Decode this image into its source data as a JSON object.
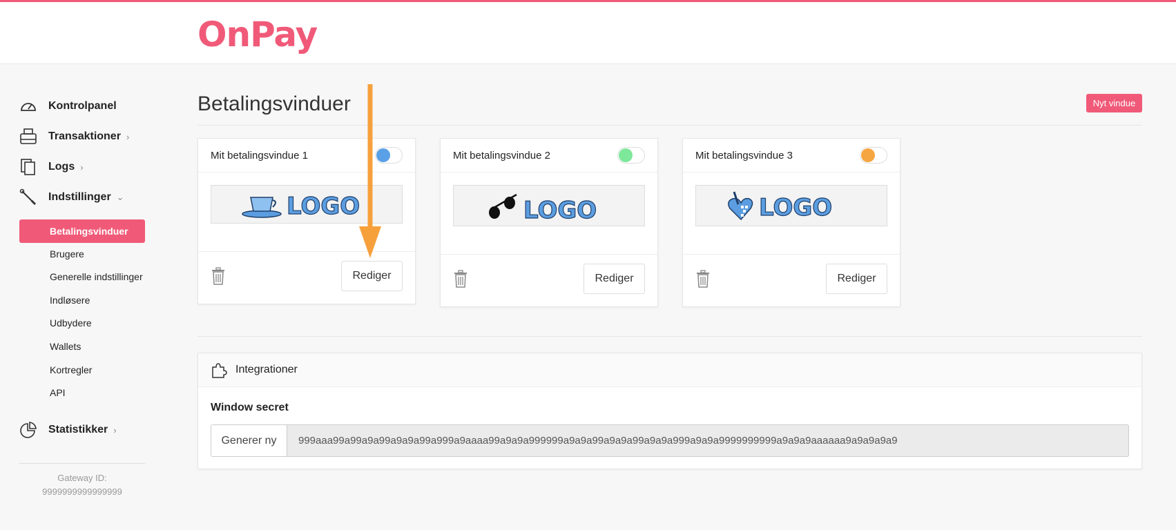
{
  "brand": {
    "name": "OnPay",
    "color": "#f05a78"
  },
  "sidebar": {
    "items": [
      {
        "label": "Kontrolpanel",
        "icon": "gauge-icon",
        "chevron": ""
      },
      {
        "label": "Transaktioner",
        "icon": "cash-register-icon",
        "chevron": "›"
      },
      {
        "label": "Logs",
        "icon": "documents-icon",
        "chevron": "›"
      },
      {
        "label": "Indstillinger",
        "icon": "wrench-icon",
        "chevron": "⌄"
      }
    ],
    "sub_items": [
      {
        "label": "Betalingsvinduer",
        "active": true
      },
      {
        "label": "Brugere"
      },
      {
        "label": "Generelle indstillinger"
      },
      {
        "label": "Indløsere"
      },
      {
        "label": "Udbydere"
      },
      {
        "label": "Wallets"
      },
      {
        "label": "Kortregler"
      },
      {
        "label": "API"
      }
    ],
    "stats": {
      "label": "Statistikker",
      "icon": "pie-chart-icon",
      "chevron": "›"
    },
    "gateway_label": "Gateway ID:",
    "gateway_id": "9999999999999999"
  },
  "main": {
    "title": "Betalingsvinduer",
    "new_button": "Nyt vindue",
    "windows": [
      {
        "name": "Mit betalingsvindue 1",
        "logo_text": "LOGO",
        "logo_icon": "teacup-icon",
        "toggle_color": "#5aa0e6",
        "edit_label": "Rediger"
      },
      {
        "name": "Mit betalingsvindue 2",
        "logo_text": "LOGO",
        "logo_icon": "sunglasses-icon",
        "toggle_color": "#7ee89a",
        "edit_label": "Rediger"
      },
      {
        "name": "Mit betalingsvindue 3",
        "logo_text": "LOGO",
        "logo_icon": "heart-hand-icon",
        "toggle_color": "#f6a641",
        "edit_label": "Rediger"
      }
    ],
    "integrations": {
      "title": "Integrationer",
      "secret_label": "Window secret",
      "generate_button": "Generer ny",
      "secret_value": "999aaa99a99a9a99a9a9a99a999a9aaaa99a9a9a999999a9a9a99a9a9a99a9a9a999a9a9a9999999999a9a9a9aaaaaa9a9a9a9a9"
    }
  },
  "annotation": {
    "arrow_color": "#f6a03c"
  }
}
